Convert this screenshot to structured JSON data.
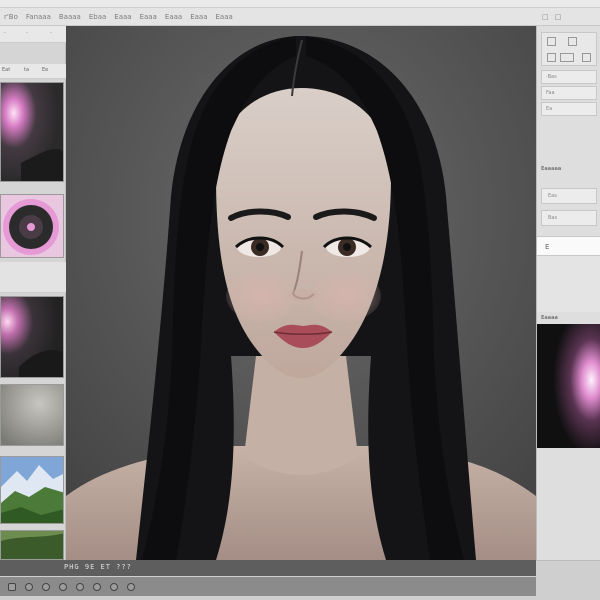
{
  "app": {
    "menu": [
      "r'Bo",
      "Fanaaa",
      "Baaaa",
      "Ebaa",
      "Eaaa",
      "Eaaa",
      "Eaaa",
      "Eaaa",
      "Eaaa"
    ],
    "window_controls": [
      "□",
      "□"
    ]
  },
  "left_panel": {
    "row1": [
      "·",
      "·",
      "·"
    ],
    "row2": [
      "Eat",
      "ta",
      "Ee"
    ]
  },
  "right_panel": {
    "toolbar_icons": [
      "pen-icon",
      "box-icon",
      "grid-icon",
      "square-icon",
      "frame-icon"
    ],
    "fields": [
      "·Bas",
      "Faa",
      "Ea"
    ],
    "section1_title": "Eaaaaa",
    "section1_fields": [
      "Eas",
      "Bas"
    ],
    "selected_item": "E",
    "section2_title": "Eaaaa"
  },
  "bottom": {
    "label": "PHG 9E  ET ???",
    "tool_icons": [
      "grid-icon",
      "circle-icon",
      "circle-icon",
      "circle-icon",
      "circle-icon",
      "circle-icon",
      "circle-icon",
      "circle-icon"
    ]
  },
  "colors": {
    "canvas_bg": "#575757",
    "accent_pink": "#e59ad6"
  }
}
